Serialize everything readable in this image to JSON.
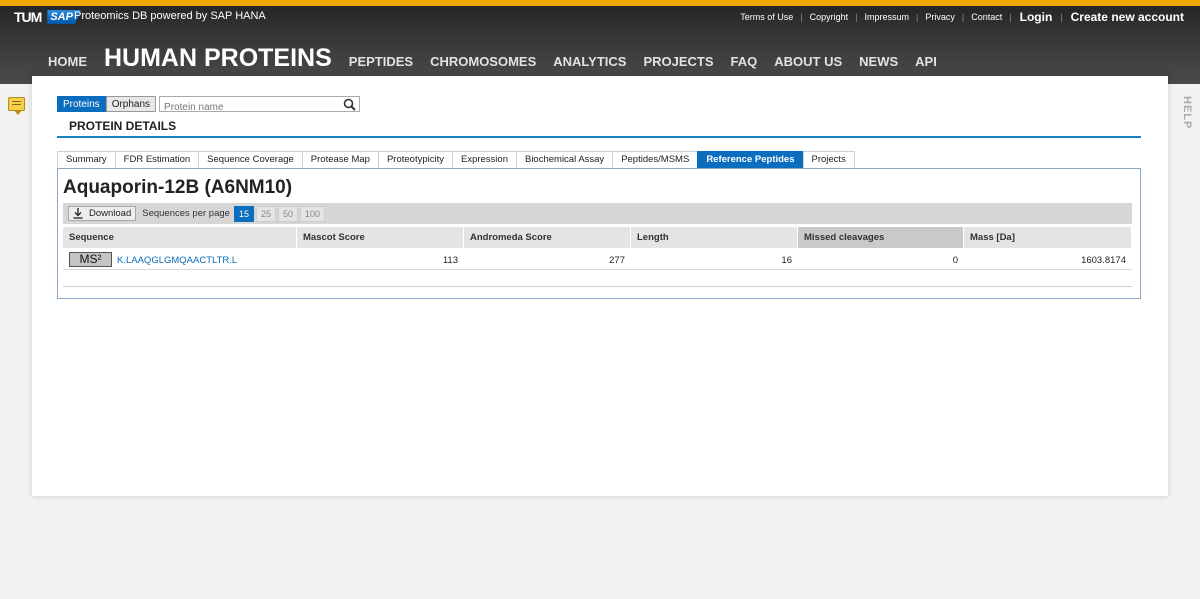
{
  "header": {
    "logo_tum": "TUM",
    "logo_sap": "SAP",
    "brand": "Proteomics DB powered by SAP HANA",
    "links": [
      "Terms of Use",
      "Copyright",
      "Impressum",
      "Privacy",
      "Contact"
    ],
    "login": "Login",
    "create_account": "Create new account"
  },
  "nav": {
    "items": [
      "HOME",
      "HUMAN PROTEINS",
      "PEPTIDES",
      "CHROMOSOMES",
      "ANALYTICS",
      "PROJECTS",
      "FAQ",
      "ABOUT US",
      "NEWS",
      "API"
    ],
    "active": "HUMAN PROTEINS"
  },
  "search": {
    "toggle_proteins": "Proteins",
    "toggle_orphans": "Orphans",
    "placeholder": "Protein name"
  },
  "section_title": "PROTEIN DETAILS",
  "help_label": "HELP",
  "tabs": [
    "Summary",
    "FDR Estimation",
    "Sequence Coverage",
    "Protease Map",
    "Proteotypicity",
    "Expression",
    "Biochemical Assay",
    "Peptides/MSMS",
    "Reference Peptides",
    "Projects"
  ],
  "active_tab": "Reference Peptides",
  "protein_title": "Aquaporin-12B (A6NM10)",
  "toolbar": {
    "download_label": "Download",
    "per_page_label": "Sequences per page",
    "per_page_options": [
      "15",
      "25",
      "50",
      "100"
    ],
    "per_page_selected": "15"
  },
  "table": {
    "columns": [
      "Sequence",
      "Mascot Score",
      "Andromeda Score",
      "Length",
      "Missed cleavages",
      "Mass [Da]"
    ],
    "sorted_column": "Missed cleavages",
    "rows": [
      {
        "badge": "MS²",
        "sequence": "K.LAAQGLGMQAACTLTR.L",
        "mascot": "113",
        "andromeda": "277",
        "length": "16",
        "missed": "0",
        "mass": "1603.8174"
      }
    ]
  },
  "colors": {
    "accent": "#0a6dbd",
    "top_stripe": "#f0a800",
    "header_bg": "#333333"
  }
}
